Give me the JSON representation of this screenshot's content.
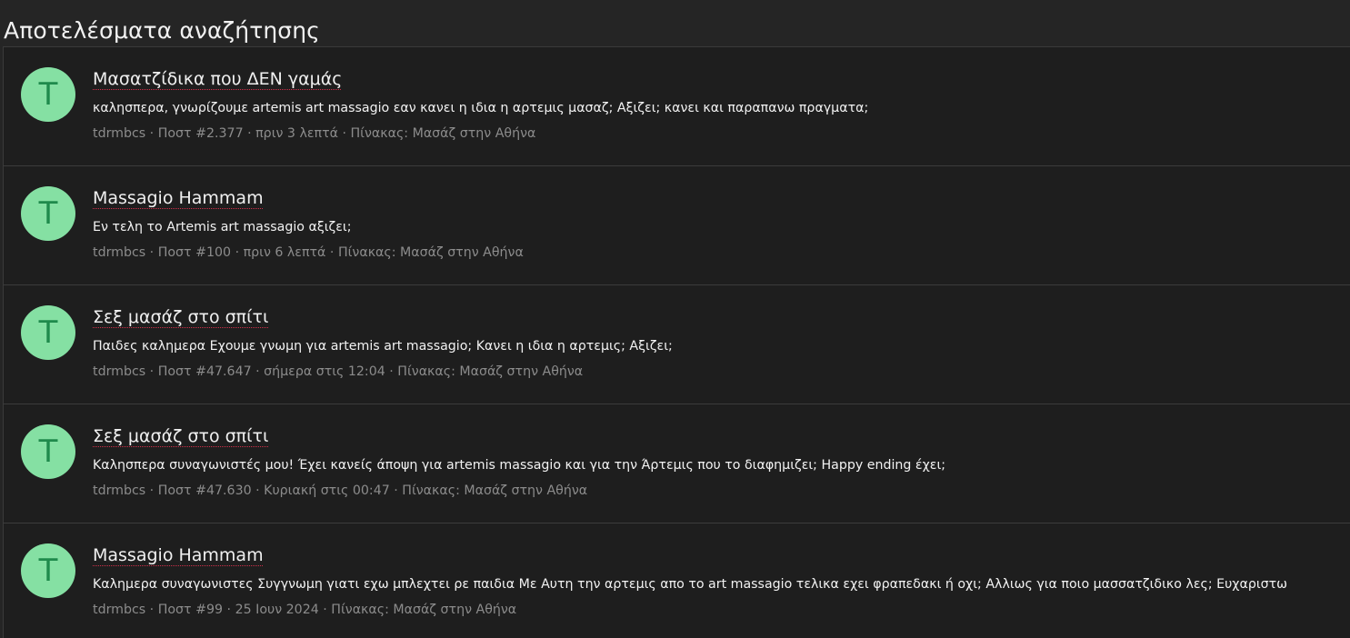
{
  "page": {
    "title": "Αποτελέσματα αναζήτησης"
  },
  "results": [
    {
      "avatar_letter": "T",
      "title": "Μασατζίδικα που ΔΕΝ γαμάς",
      "snippet": "καλησπερα, γνωρίζουμε artemis art massagio εαν κανει η ιδια η αρτεμις μασαζ; Αξιζει; κανει και παραπανω πραγματα;",
      "author": "tdrmbcs",
      "post": "Ποστ #2.377",
      "time": "πριν 3 λεπτά",
      "board": "Πίνακας: Μασάζ στην Αθήνα"
    },
    {
      "avatar_letter": "T",
      "title": "Massagio Hammam",
      "snippet": "Εν τελη το Artemis art massagio αξιζει;",
      "author": "tdrmbcs",
      "post": "Ποστ #100",
      "time": "πριν 6 λεπτά",
      "board": "Πίνακας: Μασάζ στην Αθήνα"
    },
    {
      "avatar_letter": "T",
      "title": "Σεξ μασάζ στο σπίτι",
      "snippet": "Παιδες καλημερα Εχουμε γνωμη για artemis art massagio; Κανει η ιδια η αρτεμις; Αξιζει;",
      "author": "tdrmbcs",
      "post": "Ποστ #47.647",
      "time": "σήμερα στις 12:04",
      "board": "Πίνακας: Μασάζ στην Αθήνα"
    },
    {
      "avatar_letter": "T",
      "title": "Σεξ μασάζ στο σπίτι",
      "snippet": "Καλησπερα συναγωνιστές μου! Έχει κανείς άποψη για artemis massagio και για την Άρτεμις που το διαφημιζει; Happy ending έχει;",
      "author": "tdrmbcs",
      "post": "Ποστ #47.630",
      "time": "Κυριακή στις 00:47",
      "board": "Πίνακας: Μασάζ στην Αθήνα"
    },
    {
      "avatar_letter": "T",
      "title": "Massagio Hammam",
      "snippet": "Καλημερα συναγωνιστες Συγγνωμη γιατι εχω μπλεχτει ρε παιδια Με Αυτη την αρτεμις απο το art massagio τελικα εχει φραπεδακι ή οχι; Αλλιως για ποιο μασσατζιδικο λες; Ευχαριστω",
      "author": "tdrmbcs",
      "post": "Ποστ #99",
      "time": "25 Ιουν 2024",
      "board": "Πίνακας: Μασάζ στην Αθήνα"
    }
  ],
  "colors": {
    "background": "#252525",
    "panel": "#1e1e1e",
    "avatar_bg": "#85e0a3",
    "avatar_fg": "#1f8a4c",
    "title_underline": "#d0304a",
    "meta_text": "#8c8c8c"
  }
}
